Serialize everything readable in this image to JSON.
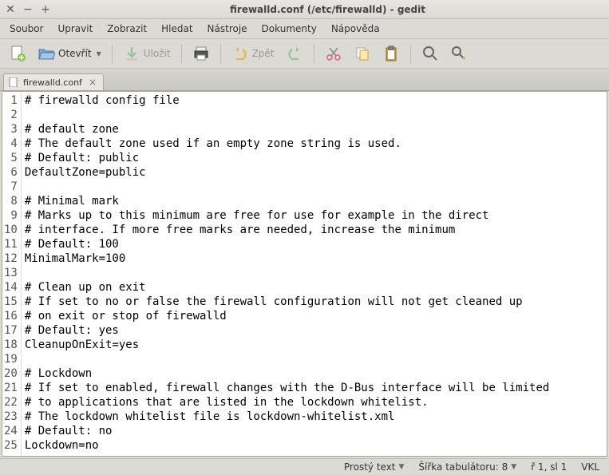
{
  "window": {
    "title": "firewalld.conf (/etc/firewalld) - gedit"
  },
  "menus": {
    "file": "Soubor",
    "edit": "Upravit",
    "view": "Zobrazit",
    "search": "Hledat",
    "tools": "Nástroje",
    "documents": "Dokumenty",
    "help": "Nápověda"
  },
  "toolbar": {
    "open": "Otevřít",
    "save": "Uložit",
    "undo": "Zpět"
  },
  "tab": {
    "name": "firewalld.conf"
  },
  "lines": [
    "# firewalld config file",
    "",
    "# default zone",
    "# The default zone used if an empty zone string is used.",
    "# Default: public",
    "DefaultZone=public",
    "",
    "# Minimal mark",
    "# Marks up to this minimum are free for use for example in the direct",
    "# interface. If more free marks are needed, increase the minimum",
    "# Default: 100",
    "MinimalMark=100",
    "",
    "# Clean up on exit",
    "# If set to no or false the firewall configuration will not get cleaned up",
    "# on exit or stop of firewalld",
    "# Default: yes",
    "CleanupOnExit=yes",
    "",
    "# Lockdown",
    "# If set to enabled, firewall changes with the D-Bus interface will be limited",
    "# to applications that are listed in the lockdown whitelist.",
    "# The lockdown whitelist file is lockdown-whitelist.xml",
    "# Default: no",
    "Lockdown=no"
  ],
  "status": {
    "filetype": "Prostý text",
    "tabwidth": "Šířka tabulátoru: 8",
    "pos": "ř 1, sl 1",
    "ins": "VKL"
  }
}
